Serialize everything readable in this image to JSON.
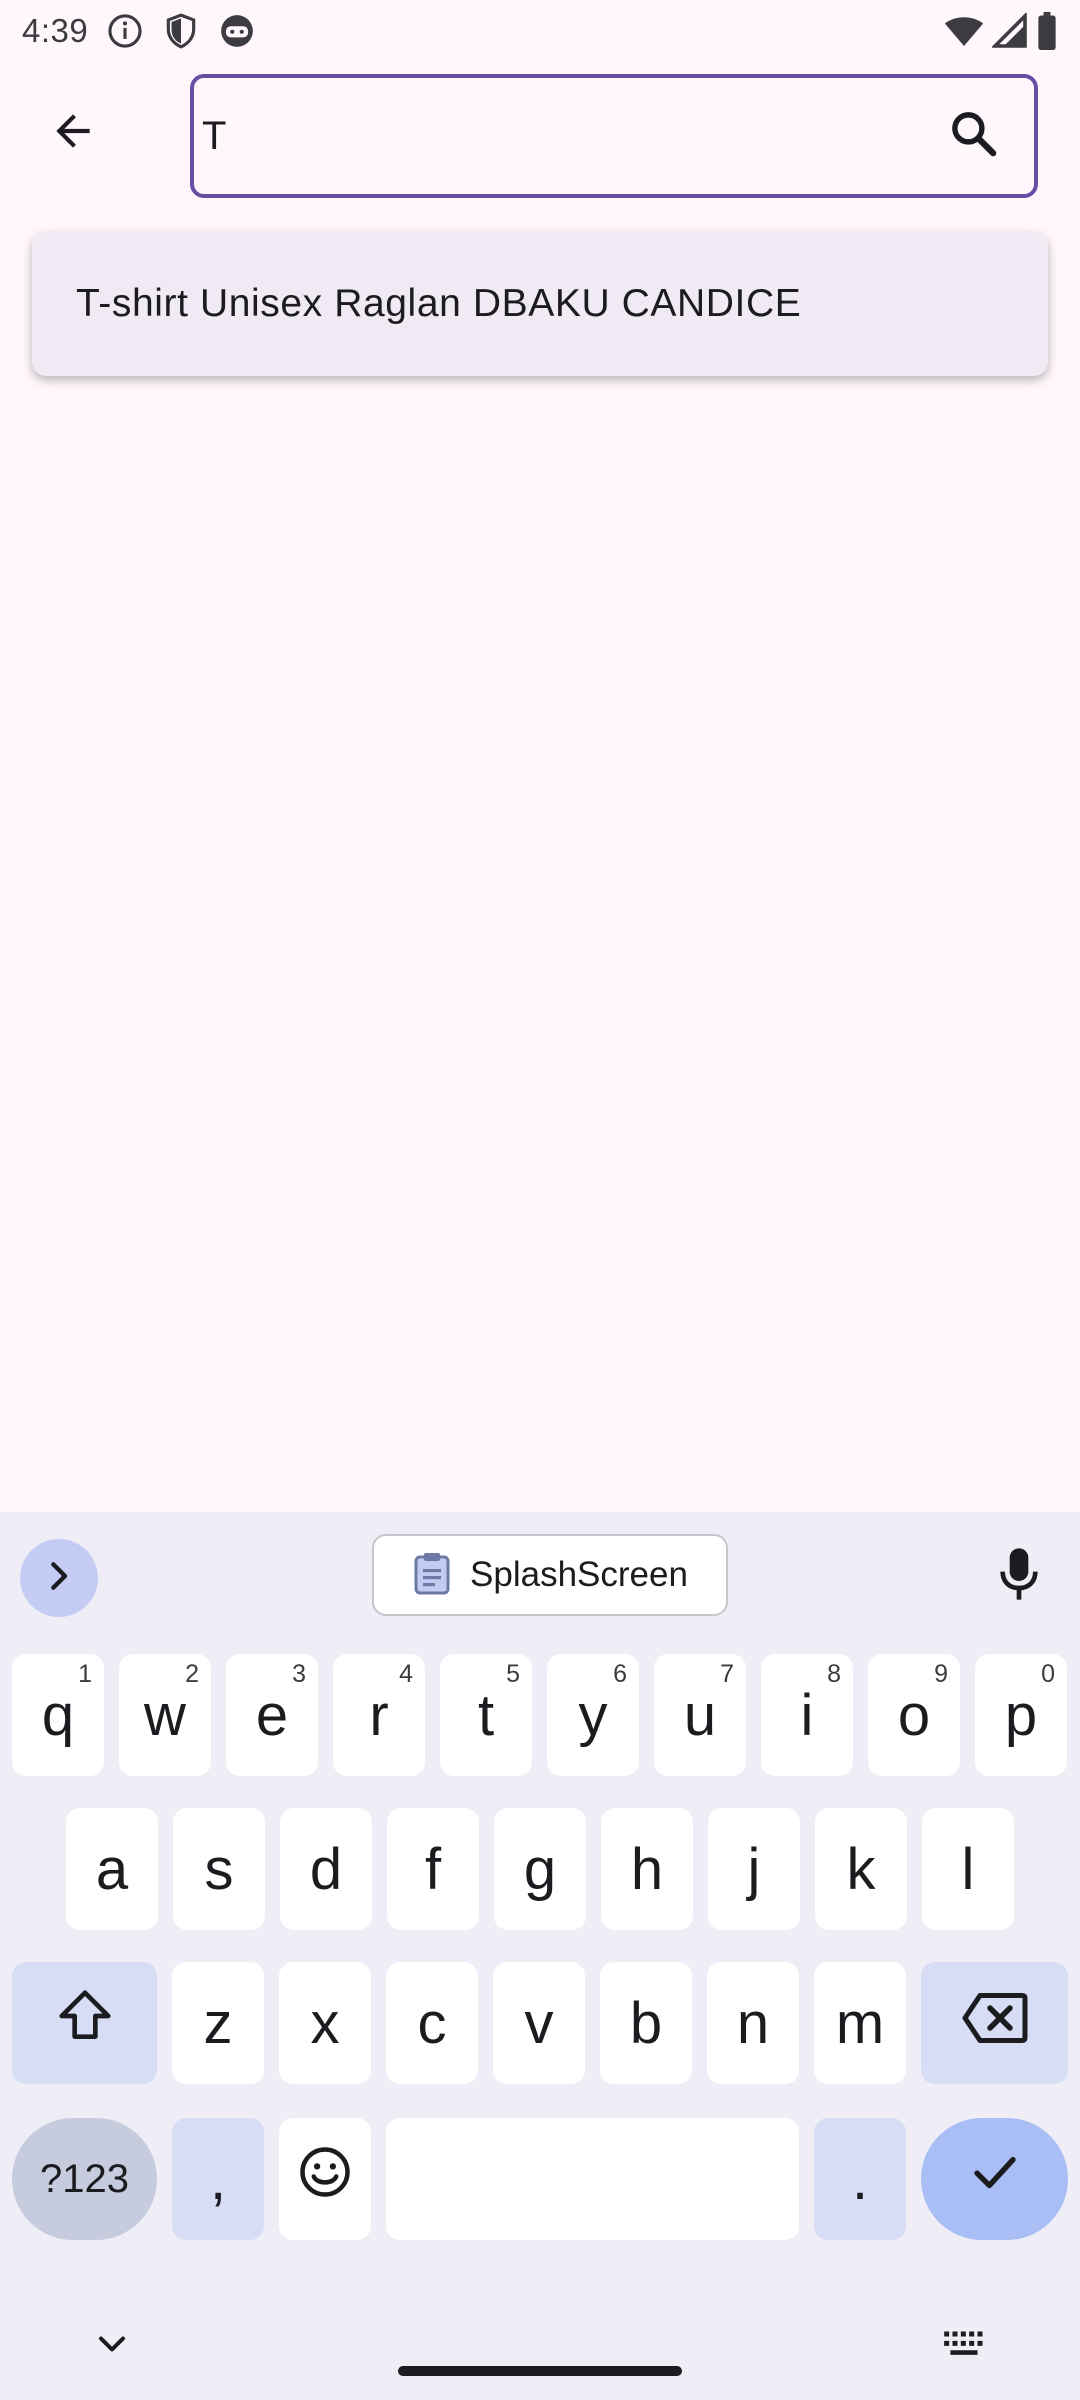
{
  "status_bar": {
    "time": "4:39",
    "icons": [
      "info-icon",
      "shield-icon",
      "android-face-icon",
      "wifi-icon",
      "signal-icon",
      "battery-icon"
    ]
  },
  "top_bar": {
    "back_icon": "arrow-left-icon",
    "search": {
      "value": "T",
      "placeholder": ""
    },
    "search_icon": "search-icon"
  },
  "suggestions": [
    {
      "label": "T-shirt Unisex Raglan DBAKU CANDICE"
    }
  ],
  "keyboard": {
    "clipboard_label": "SplashScreen",
    "row1": [
      {
        "key": "q",
        "hint": "1"
      },
      {
        "key": "w",
        "hint": "2"
      },
      {
        "key": "e",
        "hint": "3"
      },
      {
        "key": "r",
        "hint": "4"
      },
      {
        "key": "t",
        "hint": "5"
      },
      {
        "key": "y",
        "hint": "6"
      },
      {
        "key": "u",
        "hint": "7"
      },
      {
        "key": "i",
        "hint": "8"
      },
      {
        "key": "o",
        "hint": "9"
      },
      {
        "key": "p",
        "hint": "0"
      }
    ],
    "row2": [
      "a",
      "s",
      "d",
      "f",
      "g",
      "h",
      "j",
      "k",
      "l"
    ],
    "row3": [
      "z",
      "x",
      "c",
      "v",
      "b",
      "n",
      "m"
    ],
    "symbols_label": "?123",
    "comma": ",",
    "period": "."
  },
  "colors": {
    "accent": "#6750A4",
    "background": "#FFF7FB",
    "suggestion_bg": "#EFEAF3",
    "keyboard_bg": "#EFEEF6",
    "enter_key": "#A9BEF5"
  }
}
